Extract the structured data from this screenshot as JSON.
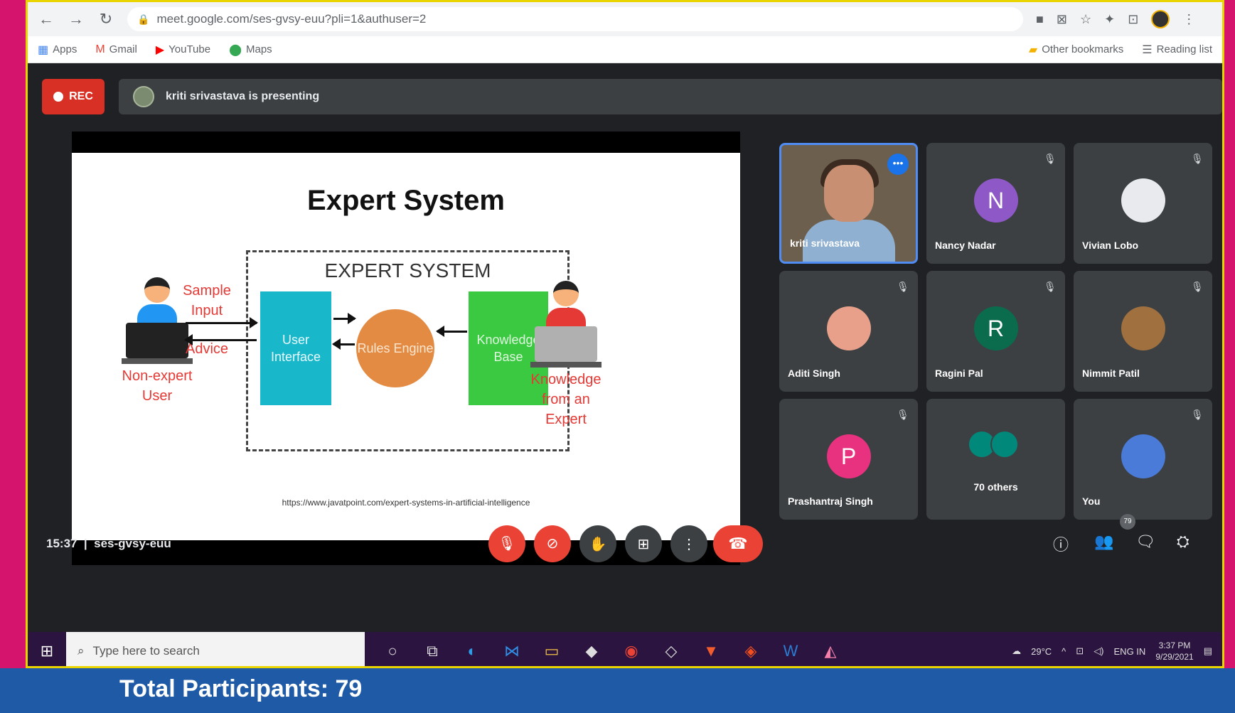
{
  "browser": {
    "url": "meet.google.com/ses-gvsy-euu?pli=1&authuser=2",
    "bookmarks": [
      "Apps",
      "Gmail",
      "YouTube",
      "Maps"
    ],
    "bookmarks_right": [
      "Other bookmarks",
      "Reading list"
    ]
  },
  "meet": {
    "rec_label": "REC",
    "presenting_text": "kriti srivastava is presenting",
    "time": "15:37",
    "meeting_code": "ses-gvsy-euu",
    "people_count": "79"
  },
  "slide": {
    "title": "Expert System",
    "box_label": "EXPERT SYSTEM",
    "user_interface": "User Interface",
    "rules_engine": "Rules Engine",
    "knowledge_base": "Knowledge Base",
    "sample_input": "Sample Input",
    "advice": "Advice",
    "non_expert": "Non-expert User",
    "knowledge_from_expert": "Knowledge from an Expert",
    "source_url": "https://www.javatpoint.com/expert-systems-in-artificial-intelligence"
  },
  "participants": [
    {
      "name": "kriti srivastava",
      "initial": ""
    },
    {
      "name": "Nancy Nadar",
      "initial": "N",
      "color": "#8e59c7"
    },
    {
      "name": "Vivian Lobo",
      "initial": ""
    },
    {
      "name": "Aditi Singh",
      "initial": ""
    },
    {
      "name": "Ragini Pal",
      "initial": "R",
      "color": "#0b6b4d"
    },
    {
      "name": "Nimmit Patil",
      "initial": ""
    },
    {
      "name": "Prashantraj Singh",
      "initial": "P",
      "color": "#e8327f"
    },
    {
      "name": "70 others",
      "initial": ""
    },
    {
      "name": "You",
      "initial": ""
    }
  ],
  "taskbar": {
    "search_placeholder": "Type here to search",
    "temperature": "29°C",
    "language": "ENG IN",
    "clock": "3:37 PM",
    "date": "9/29/2021"
  },
  "caption": "Total Participants: 79",
  "colors": {
    "accent_red": "#ea4335",
    "meet_bg": "#202124",
    "tile_bg": "#3c4043",
    "caption_bg": "#1f5aa6",
    "outer_bg": "#d5146e"
  }
}
